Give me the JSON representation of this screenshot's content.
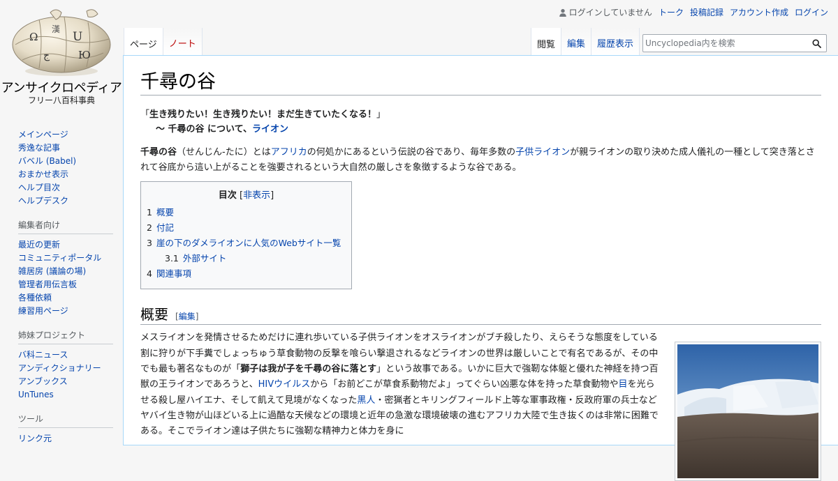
{
  "site": {
    "name": "アンサイクロペディア",
    "tagline": "フリー八百科事典",
    "logo_icon": "puzzle-globe-logo"
  },
  "personal": {
    "status": "ログインしていません",
    "talk": "トーク",
    "contribs": "投稿記録",
    "create_account": "アカウント作成",
    "login": "ログイン"
  },
  "tabs": {
    "page": "ページ",
    "talk": "ノート",
    "read": "閲覧",
    "edit": "編集",
    "history": "履歴表示"
  },
  "search": {
    "placeholder": "Uncyclopedia内を検索"
  },
  "sidebar": {
    "navigation": [
      "メインページ",
      "秀逸な記事",
      "バベル (Babel)",
      "おまかせ表示",
      "ヘルプ目次",
      "ヘルプデスク"
    ],
    "editor_title": "編集者向け",
    "editor": [
      "最近の更新",
      "コミュニティポータル",
      "雑居房 (議論の場)",
      "管理者用伝言板",
      "各種依頼",
      "練習用ページ"
    ],
    "sister_title": "姉妹プロジェクト",
    "sister": [
      "バ科ニュース",
      "アンディクショナリー",
      "アンブックス",
      "UnTunes"
    ],
    "tools_title": "ツール",
    "tools": [
      "リンク元"
    ]
  },
  "article": {
    "title": "千尋の谷",
    "quote_open": "「",
    "quote_text": "生き残りたい！生き残りたい！まだ生きていたくなる！",
    "quote_close": "」",
    "quote_attr_prefix": "〜 千尋の谷 について、",
    "quote_attr_link": "ライオン",
    "intro": {
      "bold": "千尋の谷",
      "t1": "（せんじん-たに）とは",
      "link1": "アフリカ",
      "t2": "の何処かにあるという伝説の谷であり、毎年多数の",
      "link2": "子供ライオン",
      "t3": "が親ライオンの取り決めた成人儀礼の一種として突き落とされて谷底から這い上がることを強要されるという大自然の厳しさを象徴するような谷である。"
    },
    "toc": {
      "title": "目次",
      "toggle_open": "[",
      "toggle": "非表示",
      "toggle_close": "]",
      "items": [
        {
          "num": "1",
          "label": "概要",
          "level": 1
        },
        {
          "num": "2",
          "label": "付記",
          "level": 1
        },
        {
          "num": "3",
          "label": "崖の下のダメライオンに人気のWebサイト一覧",
          "level": 1
        },
        {
          "num": "3.1",
          "label": "外部サイト",
          "level": 2
        },
        {
          "num": "4",
          "label": "関連事項",
          "level": 1
        }
      ]
    },
    "section1": {
      "heading": "概要",
      "edit_open": "[",
      "edit": "編集",
      "edit_close": "]",
      "p1": "メスライオンを発情させるためだけに連れ歩いている子供ライオンをオスライオンがブチ殺したり、えらそうな態度をしている割に狩りが下手糞でしょっちゅう草食動物の反撃を喰らい撃退されるなどライオンの世界は厳しいことで有名であるが、その中でも最も著名なものが「",
      "p1_bold": "獅子は我が子を千尋の谷に落とす",
      "p2": "」という故事である。いかに巨大で強靭な体躯と優れた神経を持つ百獣の王ライオンであろうと、",
      "link_hiv": "HIVウイルス",
      "p3": "から「お前どこが草食系動物だよ」ってぐらい凶悪な体を持った草食動物や",
      "link_eye": "目",
      "p4": "を光らせる殺し屋ハイエナ、そして飢えて見境がなくなった",
      "link_black": "黒人",
      "p5": "・密猟者とキリングフィールド上等な軍事政権・反政府軍の兵士などヤバイ生き物が山ほどいる上に過酷な天候などの環境と近年の急激な環境破壊の進むアフリカ大陸で生き抜くのは非常に困難である。そこでライオン達は子供たちに強靭な精神力と体力を身に"
    },
    "thumb_image": "mountain-glacier-photo"
  }
}
